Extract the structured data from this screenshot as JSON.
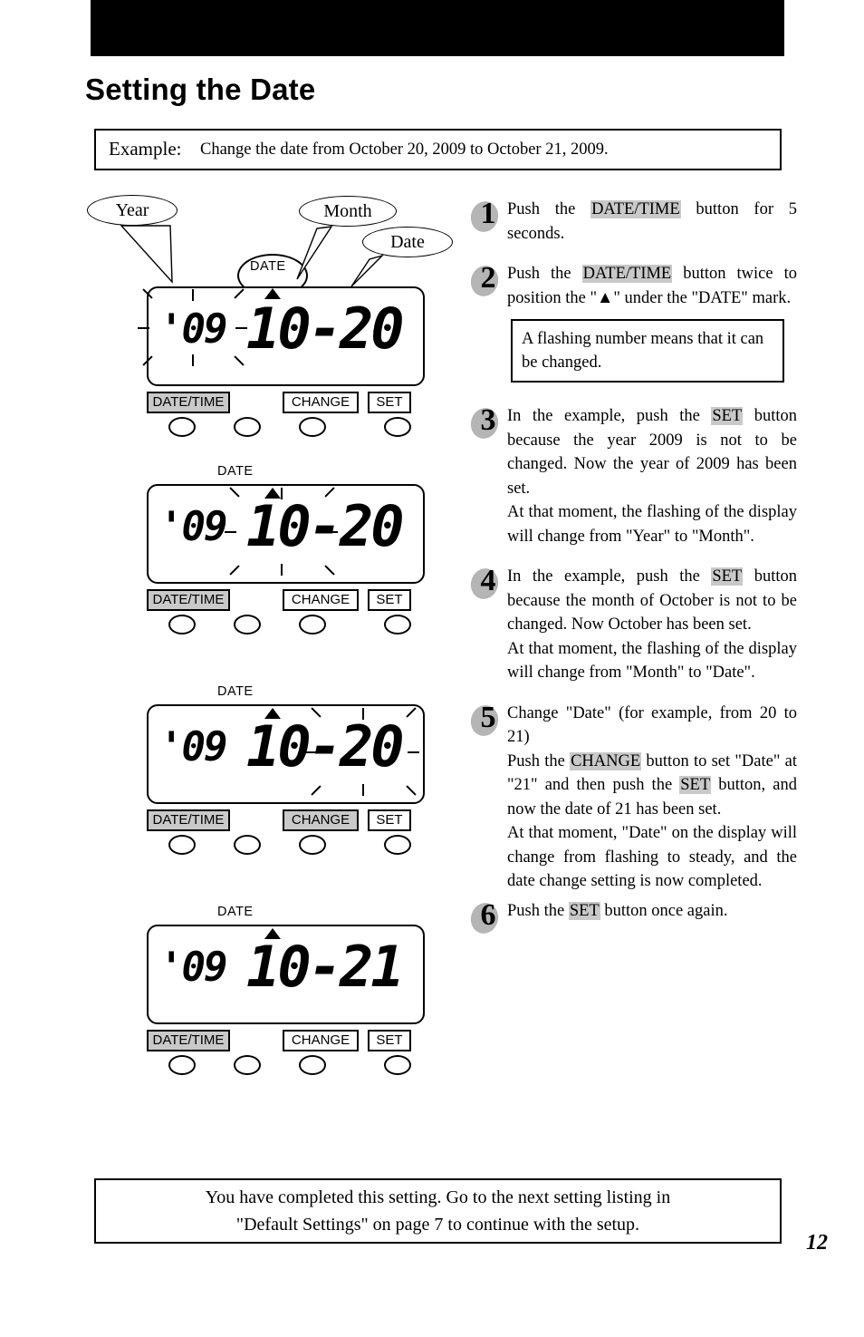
{
  "page": {
    "title": "Setting the Date",
    "page_number": "12"
  },
  "example": {
    "label": "Example:",
    "text": "Change the date from October 20, 2009 to October 21, 2009."
  },
  "callouts": {
    "year": "Year",
    "month": "Month",
    "date": "Date"
  },
  "lcd_common": {
    "date_mark": "DATE",
    "triangle": "▲",
    "buttons": [
      {
        "label": "DATE/TIME",
        "highlighted": true
      },
      {
        "label": "CHANGE",
        "highlighted": false
      },
      {
        "label": "SET",
        "highlighted": false
      }
    ]
  },
  "diagrams": [
    {
      "name": "diagram-1",
      "year": "'09",
      "month_day": "10-20",
      "flashing": "year",
      "datetime_button_gray": true,
      "change_button_gray": false
    },
    {
      "name": "diagram-2",
      "year": "'09",
      "month_day": "10-20",
      "flashing": "month",
      "datetime_button_gray": true,
      "change_button_gray": false
    },
    {
      "name": "diagram-3",
      "year": "'09",
      "month_day": "10-20",
      "flashing": "date",
      "datetime_button_gray": true,
      "change_button_gray": true
    },
    {
      "name": "diagram-4",
      "year": "'09",
      "month_day": "10-21",
      "flashing": "none",
      "datetime_button_gray": true,
      "change_button_gray": false
    }
  ],
  "steps": [
    {
      "number": "1",
      "parts": [
        {
          "t": "Push  the  ",
          "hl": false
        },
        {
          "t": "DATE/TIME",
          "hl": true
        },
        {
          "t": "  button  for  5 seconds.",
          "hl": false
        }
      ]
    },
    {
      "number": "2",
      "parts": [
        {
          "t": "Push   the  ",
          "hl": false
        },
        {
          "t": "DATE/TIME",
          "hl": true
        },
        {
          "t": "   button   twice to position the \"▲\"  under the \"DATE\" mark.",
          "hl": false
        }
      ],
      "note": "A flashing number means that it can be changed."
    },
    {
      "number": "3",
      "parts": [
        {
          "t": "In the example, push the ",
          "hl": false
        },
        {
          "t": "SET",
          "hl": true
        },
        {
          "t": " button because  the  year  2009  is  not  to  be changed. Now the year of 2009 has been set.",
          "hl": false
        }
      ],
      "paragraph2": "At that moment, the flashing of the display  will  change  from  \"Year\"  to \"Month\"."
    },
    {
      "number": "4",
      "parts": [
        {
          "t": "In the example, push the ",
          "hl": false
        },
        {
          "t": "SET",
          "hl": true
        },
        {
          "t": " button because the month of October is not to  be  changed.  Now  October  has been set.",
          "hl": false
        }
      ],
      "paragraph2": "At that moment, the flashing of the display  will  change  from  \"Month\" to \"Date\"."
    },
    {
      "number": "5",
      "parts": [
        {
          "t": "Change  \"Date\"  (for  example,  from 20 to 21)",
          "hl": false
        }
      ],
      "parts2": [
        {
          "t": "Push  the  ",
          "hl": false
        },
        {
          "t": "CHANGE",
          "hl": true
        },
        {
          "t": "  button  to  set \"Date\"  at  \"21\"  and  then  push  the ",
          "hl": false
        },
        {
          "t": "SET",
          "hl": true
        },
        {
          "t": " button, and now the date of 21 has been set.",
          "hl": false
        }
      ],
      "paragraph3": "At   that   moment,   \"Date\"   on   the display will change from flashing to steady,  and  the  date  change  setting is now completed."
    },
    {
      "number": "6",
      "parts": [
        {
          "t": "Push the ",
          "hl": false
        },
        {
          "t": "SET",
          "hl": true
        },
        {
          "t": " button once again.",
          "hl": false
        }
      ]
    }
  ],
  "footer": {
    "line1": "You have completed this setting.  Go to the next setting listing in",
    "line2": "\"Default Settings\" on page 7 to continue with the setup."
  },
  "colors": {
    "highlight": "#c9c9c9",
    "ink": "#000000",
    "paper": "#ffffff"
  }
}
